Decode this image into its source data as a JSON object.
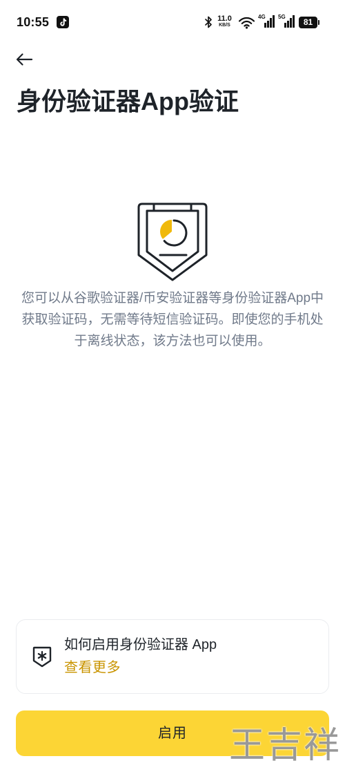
{
  "status_bar": {
    "time": "10:55",
    "notification_icon": "tiktok-icon",
    "bluetooth_icon": "bluetooth-icon",
    "net_speed_value": "11.0",
    "net_speed_unit": "KB/S",
    "wifi_icon": "wifi-icon",
    "signal_1_label": "4G",
    "signal_2_label": "5G",
    "battery_level": "81"
  },
  "header": {
    "back_icon": "arrow-left-icon",
    "title": "身份验证器App验证"
  },
  "illustration": {
    "icon": "authenticator-shield-icon"
  },
  "description": "您可以从谷歌验证器/币安验证器等身份验证器App中获取验证码，无需等待短信验证码。即使您的手机处于离线状态，该方法也可以使用。",
  "help_card": {
    "icon": "shield-asterisk-icon",
    "title": "如何启用身份验证器 App",
    "link_label": "查看更多"
  },
  "primary_button": {
    "label": "启用"
  },
  "watermark": "王吉祥",
  "colors": {
    "text_primary": "#1E2329",
    "text_secondary": "#707A8A",
    "accent_yellow": "#FCD535",
    "illustration_yellow": "#F0B90B",
    "link_gold": "#C99400",
    "card_border": "#EAECEF",
    "background": "#FFFFFF"
  }
}
